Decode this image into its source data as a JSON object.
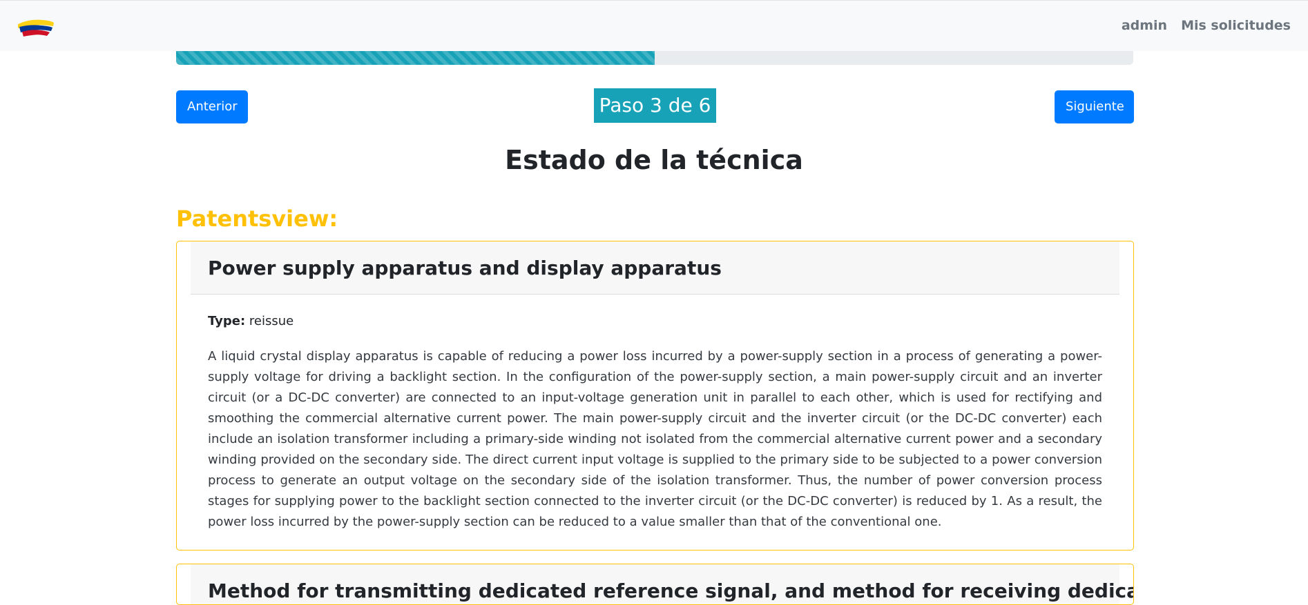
{
  "nav": {
    "user": "admin",
    "my_requests": "Mis solicitudes"
  },
  "progress": {
    "fraction": 0.5
  },
  "wizard": {
    "prev_label": "Anterior",
    "next_label": "Siguiente",
    "step_label": "Paso 3 de 6"
  },
  "page": {
    "title": "Estado de la técnica",
    "source": "Patentsview:"
  },
  "patents": [
    {
      "title": "Power supply apparatus and display apparatus",
      "type_label": "Type:",
      "type_value": "reissue",
      "abstract": "A liquid crystal display apparatus is capable of reducing a power loss incurred by a power-supply section in a process of generating a power-supply voltage for driving a backlight section. In the configuration of the power-supply section, a main power-supply circuit and an inverter circuit (or a DC-DC converter) are connected to an input-voltage generation unit in parallel to each other, which is used for rectifying and smoothing the commercial alternative current power. The main power-supply circuit and the inverter circuit (or the DC-DC converter) each include an isolation transformer including a primary-side winding not isolated from the commercial alternative current power and a secondary winding provided on the secondary side. The direct current input voltage is supplied to the primary side to be subjected to a power conversion process to generate an output voltage on the secondary side of the isolation transformer. Thus, the number of power conversion process stages for supplying power to the backlight section connected to the inverter circuit (or the DC-DC converter) is reduced by 1. As a result, the power loss incurred by the power-supply section can be reduced to a value smaller than that of the conventional one."
    },
    {
      "title": "Method for transmitting dedicated reference signal, and method for receiving dedicated"
    }
  ],
  "colors": {
    "primary": "#007bff",
    "info": "#17a2b8",
    "warning": "#ffc107"
  },
  "icons": {
    "logo": "colombia-flag-logo"
  }
}
